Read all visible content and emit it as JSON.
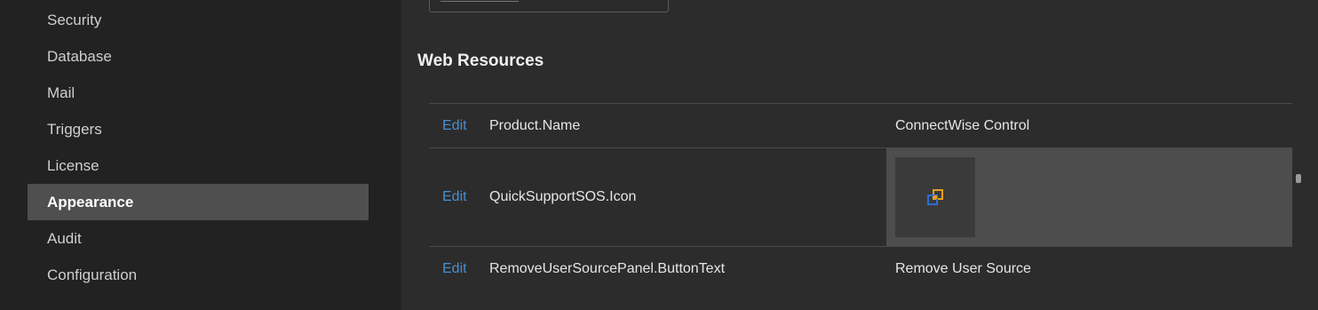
{
  "sidebar": {
    "items": [
      {
        "label": "Security",
        "active": false
      },
      {
        "label": "Database",
        "active": false
      },
      {
        "label": "Mail",
        "active": false
      },
      {
        "label": "Triggers",
        "active": false
      },
      {
        "label": "License",
        "active": false
      },
      {
        "label": "Appearance",
        "active": true
      },
      {
        "label": "Audit",
        "active": false
      },
      {
        "label": "Configuration",
        "active": false
      }
    ]
  },
  "main": {
    "section_title": "Web Resources",
    "resources": [
      {
        "edit_label": "Edit",
        "name": "Product.Name",
        "value": "ConnectWise Control"
      },
      {
        "edit_label": "Edit",
        "name": "QuickSupportSOS.Icon",
        "value_icon": "quick-support-sos-icon"
      },
      {
        "edit_label": "Edit",
        "name": "RemoveUserSourcePanel.ButtonText",
        "value": "Remove User Source"
      }
    ]
  },
  "colors": {
    "accent_link": "#4a8fd1",
    "active_nav_bg": "#4f4f4f",
    "sidebar_bg": "#222222",
    "main_bg": "#2c2c2c"
  }
}
